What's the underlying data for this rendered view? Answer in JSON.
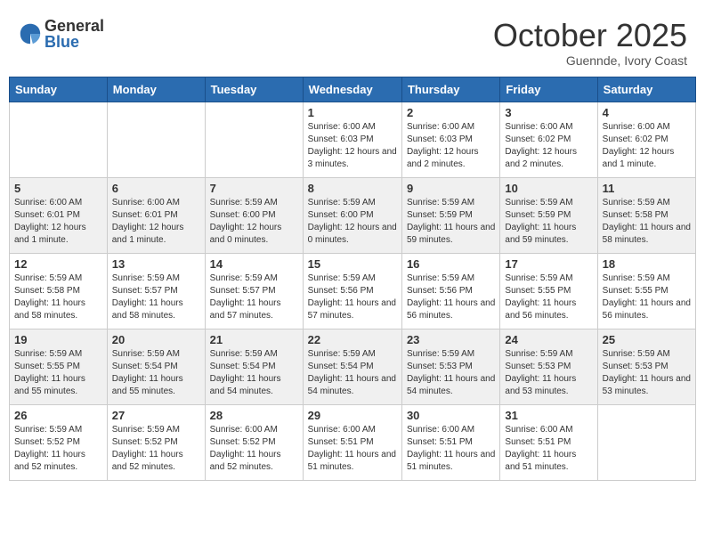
{
  "header": {
    "logo_general": "General",
    "logo_blue": "Blue",
    "month": "October 2025",
    "location": "Guennde, Ivory Coast"
  },
  "days_of_week": [
    "Sunday",
    "Monday",
    "Tuesday",
    "Wednesday",
    "Thursday",
    "Friday",
    "Saturday"
  ],
  "weeks": [
    [
      {
        "day": "",
        "info": ""
      },
      {
        "day": "",
        "info": ""
      },
      {
        "day": "",
        "info": ""
      },
      {
        "day": "1",
        "info": "Sunrise: 6:00 AM\nSunset: 6:03 PM\nDaylight: 12 hours and 3 minutes."
      },
      {
        "day": "2",
        "info": "Sunrise: 6:00 AM\nSunset: 6:03 PM\nDaylight: 12 hours and 2 minutes."
      },
      {
        "day": "3",
        "info": "Sunrise: 6:00 AM\nSunset: 6:02 PM\nDaylight: 12 hours and 2 minutes."
      },
      {
        "day": "4",
        "info": "Sunrise: 6:00 AM\nSunset: 6:02 PM\nDaylight: 12 hours and 1 minute."
      }
    ],
    [
      {
        "day": "5",
        "info": "Sunrise: 6:00 AM\nSunset: 6:01 PM\nDaylight: 12 hours and 1 minute."
      },
      {
        "day": "6",
        "info": "Sunrise: 6:00 AM\nSunset: 6:01 PM\nDaylight: 12 hours and 1 minute."
      },
      {
        "day": "7",
        "info": "Sunrise: 5:59 AM\nSunset: 6:00 PM\nDaylight: 12 hours and 0 minutes."
      },
      {
        "day": "8",
        "info": "Sunrise: 5:59 AM\nSunset: 6:00 PM\nDaylight: 12 hours and 0 minutes."
      },
      {
        "day": "9",
        "info": "Sunrise: 5:59 AM\nSunset: 5:59 PM\nDaylight: 11 hours and 59 minutes."
      },
      {
        "day": "10",
        "info": "Sunrise: 5:59 AM\nSunset: 5:59 PM\nDaylight: 11 hours and 59 minutes."
      },
      {
        "day": "11",
        "info": "Sunrise: 5:59 AM\nSunset: 5:58 PM\nDaylight: 11 hours and 58 minutes."
      }
    ],
    [
      {
        "day": "12",
        "info": "Sunrise: 5:59 AM\nSunset: 5:58 PM\nDaylight: 11 hours and 58 minutes."
      },
      {
        "day": "13",
        "info": "Sunrise: 5:59 AM\nSunset: 5:57 PM\nDaylight: 11 hours and 58 minutes."
      },
      {
        "day": "14",
        "info": "Sunrise: 5:59 AM\nSunset: 5:57 PM\nDaylight: 11 hours and 57 minutes."
      },
      {
        "day": "15",
        "info": "Sunrise: 5:59 AM\nSunset: 5:56 PM\nDaylight: 11 hours and 57 minutes."
      },
      {
        "day": "16",
        "info": "Sunrise: 5:59 AM\nSunset: 5:56 PM\nDaylight: 11 hours and 56 minutes."
      },
      {
        "day": "17",
        "info": "Sunrise: 5:59 AM\nSunset: 5:55 PM\nDaylight: 11 hours and 56 minutes."
      },
      {
        "day": "18",
        "info": "Sunrise: 5:59 AM\nSunset: 5:55 PM\nDaylight: 11 hours and 56 minutes."
      }
    ],
    [
      {
        "day": "19",
        "info": "Sunrise: 5:59 AM\nSunset: 5:55 PM\nDaylight: 11 hours and 55 minutes."
      },
      {
        "day": "20",
        "info": "Sunrise: 5:59 AM\nSunset: 5:54 PM\nDaylight: 11 hours and 55 minutes."
      },
      {
        "day": "21",
        "info": "Sunrise: 5:59 AM\nSunset: 5:54 PM\nDaylight: 11 hours and 54 minutes."
      },
      {
        "day": "22",
        "info": "Sunrise: 5:59 AM\nSunset: 5:54 PM\nDaylight: 11 hours and 54 minutes."
      },
      {
        "day": "23",
        "info": "Sunrise: 5:59 AM\nSunset: 5:53 PM\nDaylight: 11 hours and 54 minutes."
      },
      {
        "day": "24",
        "info": "Sunrise: 5:59 AM\nSunset: 5:53 PM\nDaylight: 11 hours and 53 minutes."
      },
      {
        "day": "25",
        "info": "Sunrise: 5:59 AM\nSunset: 5:53 PM\nDaylight: 11 hours and 53 minutes."
      }
    ],
    [
      {
        "day": "26",
        "info": "Sunrise: 5:59 AM\nSunset: 5:52 PM\nDaylight: 11 hours and 52 minutes."
      },
      {
        "day": "27",
        "info": "Sunrise: 5:59 AM\nSunset: 5:52 PM\nDaylight: 11 hours and 52 minutes."
      },
      {
        "day": "28",
        "info": "Sunrise: 6:00 AM\nSunset: 5:52 PM\nDaylight: 11 hours and 52 minutes."
      },
      {
        "day": "29",
        "info": "Sunrise: 6:00 AM\nSunset: 5:51 PM\nDaylight: 11 hours and 51 minutes."
      },
      {
        "day": "30",
        "info": "Sunrise: 6:00 AM\nSunset: 5:51 PM\nDaylight: 11 hours and 51 minutes."
      },
      {
        "day": "31",
        "info": "Sunrise: 6:00 AM\nSunset: 5:51 PM\nDaylight: 11 hours and 51 minutes."
      },
      {
        "day": "",
        "info": ""
      }
    ]
  ]
}
